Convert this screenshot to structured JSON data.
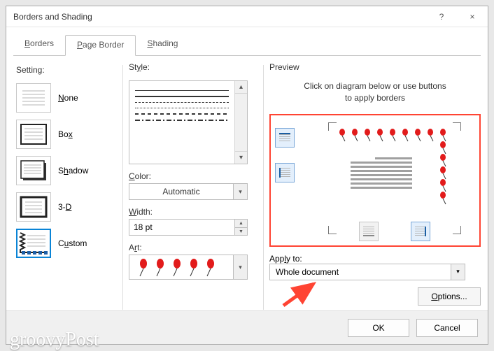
{
  "window": {
    "title": "Borders and Shading",
    "help": "?",
    "close": "×"
  },
  "tabs": {
    "borders": "Borders",
    "page_border": "Page Border",
    "shading": "Shading"
  },
  "setting": {
    "label": "Setting:",
    "items": [
      {
        "label": "None",
        "u": "N"
      },
      {
        "label": "Box",
        "u": "x"
      },
      {
        "label": "Shadow",
        "u": "h"
      },
      {
        "label": "3-D",
        "u": "D"
      },
      {
        "label": "Custom",
        "u": "u"
      }
    ]
  },
  "style": {
    "label": "Style:",
    "color_label": "Color:",
    "color_value": "Automatic",
    "width_label": "Width:",
    "width_value": "18 pt",
    "art_label": "Art:"
  },
  "preview": {
    "label": "Preview",
    "hint1": "Click on diagram below or use buttons",
    "hint2": "to apply borders"
  },
  "apply": {
    "label": "Apply to:",
    "value": "Whole document",
    "options_label": "Options..."
  },
  "footer": {
    "ok": "OK",
    "cancel": "Cancel"
  },
  "watermark": "groovyPost"
}
